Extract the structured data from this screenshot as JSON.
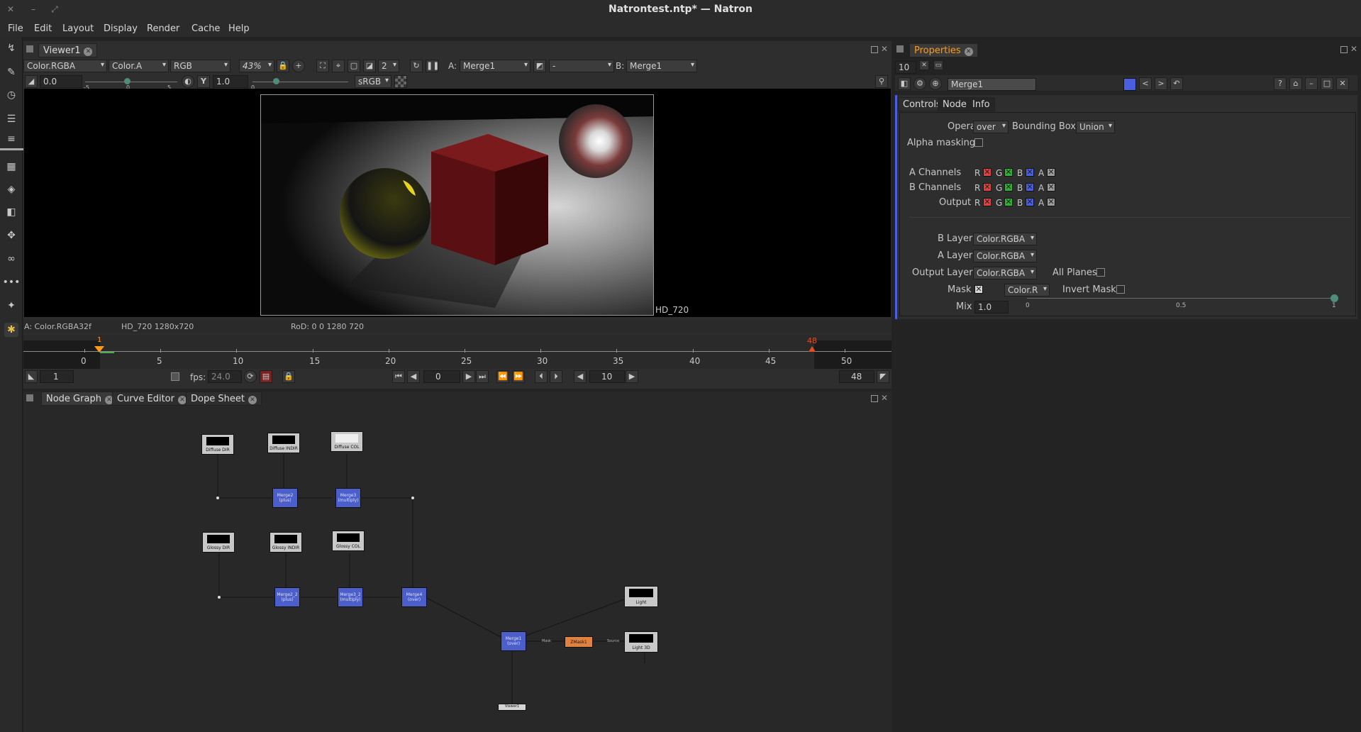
{
  "window": {
    "title": "Natrontest.ntp* — Natron"
  },
  "menu": [
    "File",
    "Edit",
    "Layout",
    "Display",
    "Render",
    "Cache",
    "Help"
  ],
  "viewer": {
    "tab_label": "Viewer1",
    "layer": "Color.RGBA",
    "alpha_channel": "Color.A",
    "display_channels": "RGB",
    "zoom": "43%",
    "proxy_level": "2",
    "input_a_label": "A:",
    "input_a": "Merge1",
    "operator": "-",
    "input_b_label": "B:",
    "input_b": "Merge1",
    "gain": "0.0",
    "gain_ticks": [
      "-5",
      "0",
      "5"
    ],
    "gamma_icon": "Y",
    "gamma": "1.0",
    "gamma_tick": "0",
    "colorspace": "sRGB",
    "format_overlay": "HD_720",
    "info_left": "A: Color.RGBA32f",
    "info_format": "HD_720 1280x720",
    "info_rod": "RoD: 0 0 1280 720"
  },
  "timeline": {
    "ticks": [
      "0",
      "5",
      "10",
      "15",
      "20",
      "25",
      "30",
      "35",
      "40",
      "45",
      "50"
    ],
    "start_marker": "1",
    "end_marker": "48",
    "start_frame": "1",
    "fps_label": "fps:",
    "fps": "24.0",
    "current_frame": "0",
    "increment": "10",
    "end_frame": "48"
  },
  "bottom_tabs": [
    "Node Graph",
    "Curve Editor",
    "Dope Sheet"
  ],
  "node_graph": {
    "readers_top": [
      "Diffuse DIR",
      "Diffuse INDIR",
      "Diffuse COL"
    ],
    "readers_mid": [
      "Glossy DIR",
      "Glossy INDIR",
      "Glossy COL"
    ],
    "merges": [
      {
        "name": "Merge2",
        "op": "(plus)"
      },
      {
        "name": "Merge3",
        "op": "(multiply)"
      },
      {
        "name": "Merge2_2",
        "op": "(plus)"
      },
      {
        "name": "Merge3_2",
        "op": "(multiply)"
      },
      {
        "name": "Merge4",
        "op": "(over)"
      },
      {
        "name": "Merge1",
        "op": "(over)"
      }
    ],
    "zmask": "ZMask1",
    "light": "Light",
    "light_3d": "Light 3D",
    "viewer": "Viewer1",
    "edge_mask": "Mask",
    "edge_source": "Source"
  },
  "properties": {
    "tab_label": "Properties",
    "max_panels": "10",
    "node_name": "Merge1",
    "subtabs": [
      "Controls",
      "Node",
      "Info"
    ],
    "operation_label": "Operation",
    "operation": "over",
    "bbox_label": "Bounding Box",
    "bbox": "Union",
    "alpha_masking_label": "Alpha masking",
    "a_channels_label": "A Channels",
    "b_channels_label": "B Channels",
    "output_label": "Output",
    "channel_letters": [
      "R",
      "G",
      "B",
      "A"
    ],
    "b_layer_label": "B Layer",
    "b_layer": "Color.RGBA",
    "a_layer_label": "A Layer",
    "a_layer": "Color.RGBA",
    "output_layer_label": "Output Layer",
    "output_layer": "Color.RGBA",
    "all_planes_label": "All Planes",
    "mask_label": "Mask",
    "mask_channel": "Color.R",
    "invert_mask_label": "Invert Mask",
    "mix_label": "Mix",
    "mix": "1.0",
    "mix_ticks": [
      "0",
      "0.5",
      "1"
    ]
  },
  "colors": {
    "accent_orange": "#ff9a1a",
    "merge_node": "#4b5ec9",
    "zmask_node": "#e0823f",
    "channel_red": "#e04040",
    "channel_green": "#30b030",
    "channel_blue": "#4a5ee0"
  }
}
